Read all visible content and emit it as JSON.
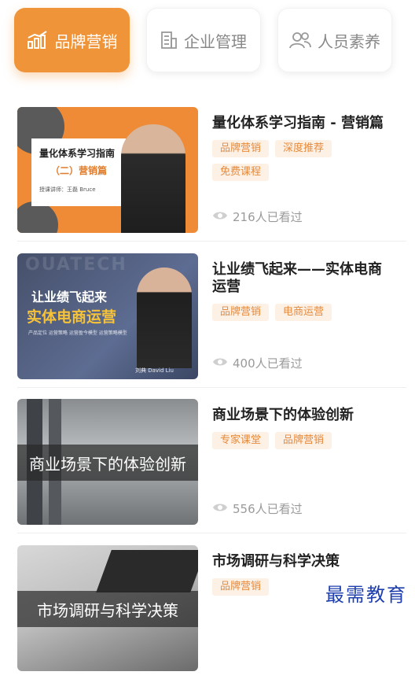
{
  "tabs": [
    {
      "label": "品牌营销",
      "icon": "bar-chart-icon",
      "active": true
    },
    {
      "label": "企业管理",
      "icon": "building-icon",
      "active": false
    },
    {
      "label": "人员素养",
      "icon": "people-icon",
      "active": false
    }
  ],
  "courses": [
    {
      "title": "量化体系学习指南 - 营销篇",
      "tags": [
        "品牌营销",
        "深度推荐",
        "免费课程"
      ],
      "views": "216人已看过",
      "thumb": {
        "line1": "量化体系学习指南",
        "line2": "（二）营销篇",
        "line3": "授课讲师：王磊 Bruce"
      }
    },
    {
      "title": "让业绩飞起来——实体电商运营",
      "tags": [
        "品牌营销",
        "电商运营"
      ],
      "views": "400人已看过",
      "thumb": {
        "watermark": "OUATECH",
        "line1": "让业绩飞起来",
        "line2": "实体电商运营",
        "line3": "产品定位 运营策略 运营盈今模型 运营策略模型",
        "presenter": "刘典 David Liu"
      }
    },
    {
      "title": "商业场景下的体验创新",
      "tags": [
        "专家课堂",
        "品牌营销"
      ],
      "views": "556人已看过",
      "thumb": {
        "overlay": "商业场景下的体验创新"
      }
    },
    {
      "title": "市场调研与科学决策",
      "tags": [
        "品牌营销"
      ],
      "views": "",
      "thumb": {
        "overlay": "市场调研与科学决策"
      }
    }
  ],
  "watermark": "最需教育",
  "colors": {
    "accent": "#f0943a",
    "tag_bg": "#fdf0e4",
    "tag_text": "#e68a3c"
  }
}
